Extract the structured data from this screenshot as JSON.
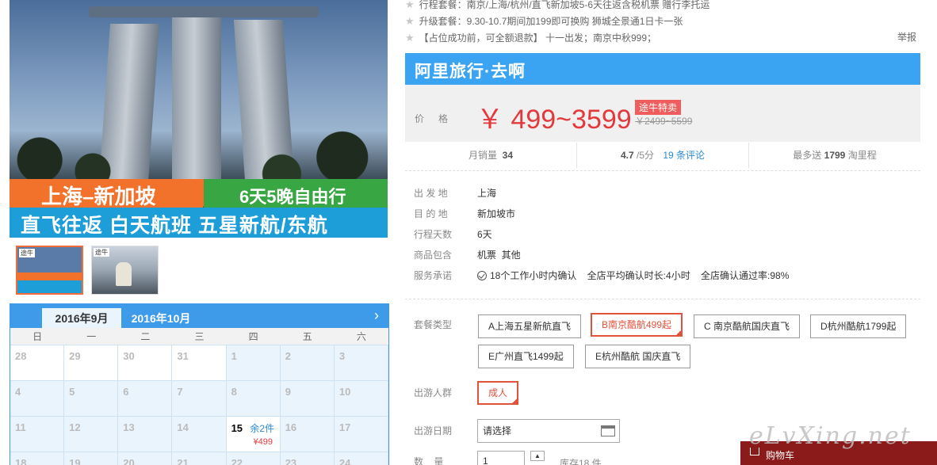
{
  "hero": {
    "route": "上海–新加坡",
    "days": "6天5晚自由行",
    "subtitle": "直飞往返 白天航班 五星新航/东航"
  },
  "thumbs": [
    {
      "tag": "途牛"
    },
    {
      "tag": "途牛"
    }
  ],
  "calendar": {
    "tabs": [
      "2016年9月",
      "2016年10月"
    ],
    "next_icon": "chevron-right-icon",
    "weekdays": [
      "日",
      "一",
      "二",
      "三",
      "四",
      "五",
      "六"
    ],
    "rows": [
      [
        "28",
        "29",
        "30",
        "31",
        "1",
        "2",
        "3"
      ],
      [
        "4",
        "5",
        "6",
        "7",
        "8",
        "9",
        "10"
      ],
      [
        "11",
        "12",
        "13",
        "14",
        "15",
        "16",
        "17"
      ],
      [
        "18",
        "19",
        "20",
        "21",
        "22",
        "23",
        "24"
      ]
    ],
    "avail_date": "15",
    "avail_remaining": "余2件",
    "avail_price": "¥499"
  },
  "announcements": [
    "行程套餐：南京/上海/杭州/直飞新加坡5-6天往返含税机票 赠行李托运",
    "升级套餐：9.30-10.7期间加199即可换购 狮城全景通1日卡一张",
    "【占位成功前，可全额退款】 十一出发；南京中秋999；"
  ],
  "report_label": "举报",
  "brand_title": "阿里旅行·去啊",
  "price": {
    "label": "价格",
    "value": "￥ 499~3599",
    "badge": "途牛特卖",
    "original": "￥2499~5599"
  },
  "stats": {
    "monthly_sales_label": "月销量",
    "monthly_sales": "34",
    "rating": "4.7",
    "rating_suffix": "/5分",
    "reviews": "19 条评论",
    "points_prefix": "最多送",
    "points": "1799",
    "points_suffix": "淘里程"
  },
  "info": [
    {
      "k": "出 发 地",
      "v": "上海"
    },
    {
      "k": "目 的 地",
      "v": "新加坡市"
    },
    {
      "k": "行程天数",
      "v": "6天"
    },
    {
      "k": "商品包含",
      "v": "机票  其他"
    },
    {
      "k": "服务承诺",
      "v": "18个工作小时内确认    全店平均确认时长:4小时    全店确认通过率:98%"
    }
  ],
  "package": {
    "label": "套餐类型",
    "options": [
      "A上海五星新航直飞",
      "B南京酷航499起",
      "C 南京酷航国庆直飞",
      "D杭州酷航1799起",
      "E广州直飞1499起",
      "E杭州酷航 国庆直飞"
    ]
  },
  "traveler": {
    "label": "出游人群",
    "option": "成人"
  },
  "date": {
    "label": "出游日期",
    "placeholder": "请选择"
  },
  "quantity": {
    "label": "数    量",
    "value": "1",
    "stock": "库存18 件"
  },
  "cart_label": "购物车",
  "watermark": "eLvXing.net"
}
